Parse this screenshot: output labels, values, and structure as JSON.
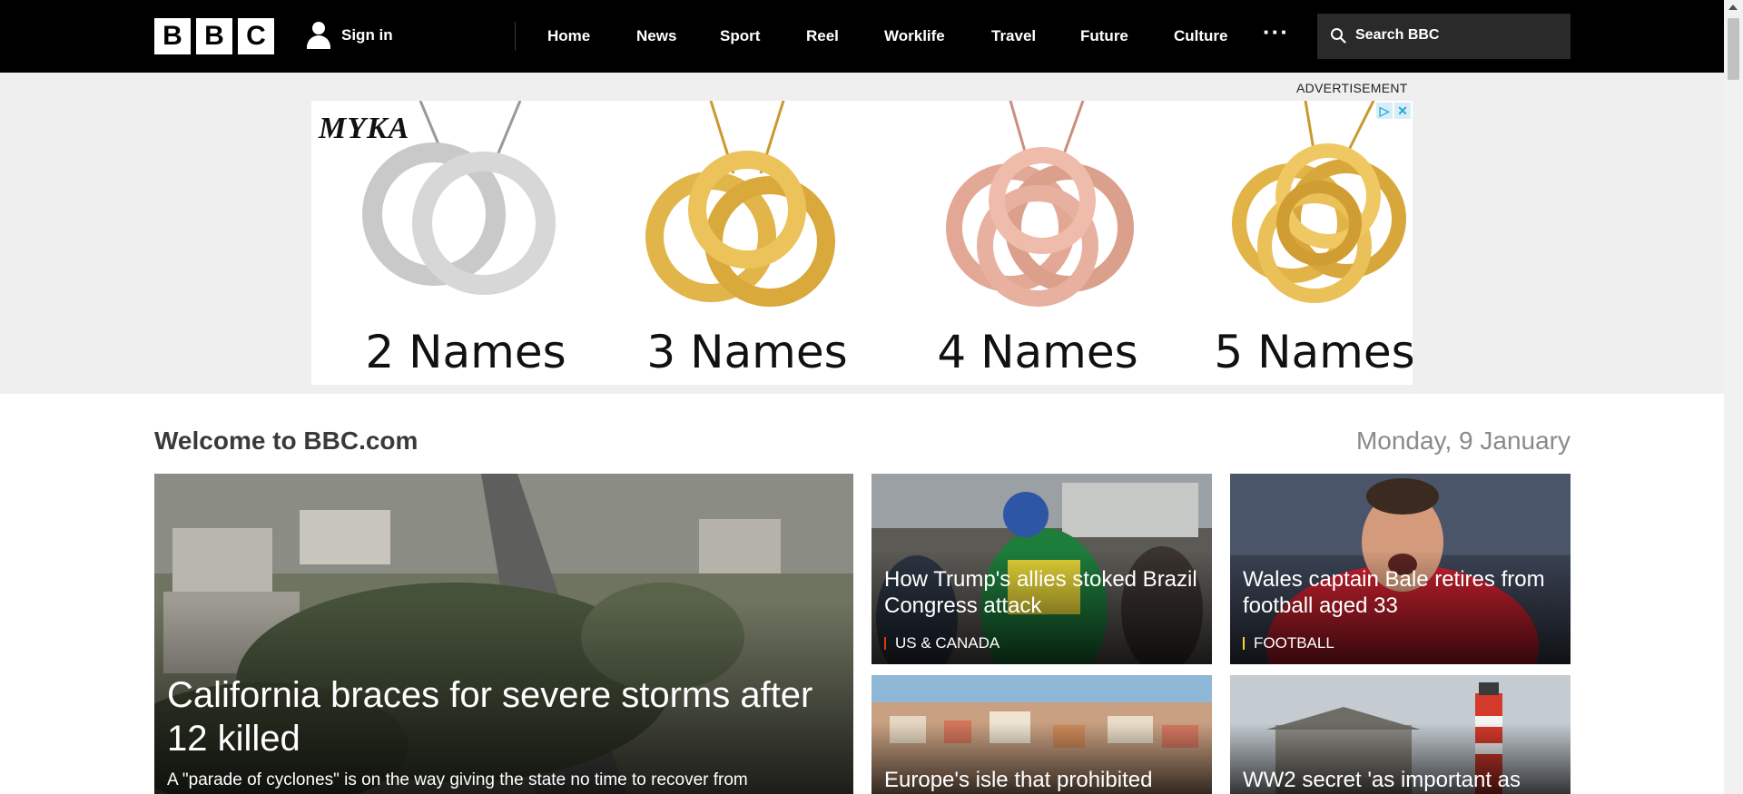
{
  "header": {
    "logo_letters": [
      "B",
      "B",
      "C"
    ],
    "signin_label": "Sign in",
    "nav": [
      "Home",
      "News",
      "Sport",
      "Reel",
      "Worklife",
      "Travel",
      "Future",
      "Culture"
    ],
    "more_label": "···",
    "search_placeholder": "Search BBC"
  },
  "ad": {
    "label": "ADVERTISEMENT",
    "brand": "MYKA",
    "products": [
      {
        "caption": "2 Names",
        "color": "#c9c9c9"
      },
      {
        "caption": "3 Names",
        "color": "#e1b54a"
      },
      {
        "caption": "4 Names",
        "color": "#e3a895"
      },
      {
        "caption": "5 Names",
        "color": "#e2b447"
      }
    ],
    "adchoices": [
      "▷",
      "✕"
    ]
  },
  "main": {
    "welcome": "Welcome to BBC.com",
    "date": "Monday, 9 January",
    "stories": [
      {
        "title": "California braces for severe storms after 12 killed",
        "summary": "A \"parade of cyclones\" is on the way giving the state no time to recover from",
        "tag": ""
      },
      {
        "title": "How Trump's allies stoked Brazil Congress attack",
        "tag": "US & CANADA",
        "tag_color": "#d93c0b"
      },
      {
        "title": "Wales captain Bale retires from football aged 33",
        "tag": "FOOTBALL",
        "tag_color": "#ffd230"
      },
      {
        "title": "Europe's isle that prohibited",
        "tag": ""
      },
      {
        "title": "WW2 secret 'as important as",
        "tag": ""
      }
    ]
  }
}
